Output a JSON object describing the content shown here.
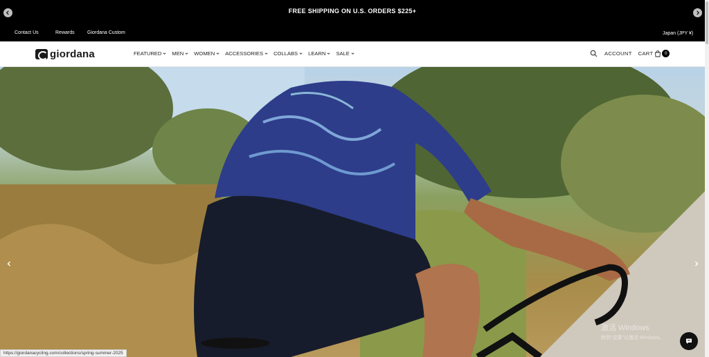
{
  "announcement": {
    "text": "FREE SHIPPING ON U.S. ORDERS $225+"
  },
  "utility": {
    "links": [
      "Contact Us",
      "Rewards",
      "Giordana Custom"
    ],
    "locale": "Japan (JPY ¥)"
  },
  "brand": {
    "name": "giordana"
  },
  "nav": {
    "items": [
      "FEATURED",
      "MEN",
      "WOMEN",
      "ACCESSORIES",
      "COLLABS",
      "LEARN",
      "SALE"
    ]
  },
  "header_right": {
    "account": "ACCOUNT",
    "cart": "CART",
    "cart_count": "0"
  },
  "status_bar": {
    "url": "https://giordanacycling.com/collections/spring-summer-2025"
  },
  "watermark": {
    "title": "激活 Windows",
    "subtitle": "转到\"设置\"以激活 Windows。"
  },
  "icons": {
    "search": "search-icon",
    "bag": "bag-icon",
    "chat": "chat-icon",
    "prev": "chevron-left-icon",
    "next": "chevron-right-icon"
  },
  "colors": {
    "bar_bg": "#000000",
    "accent": "#000000"
  }
}
